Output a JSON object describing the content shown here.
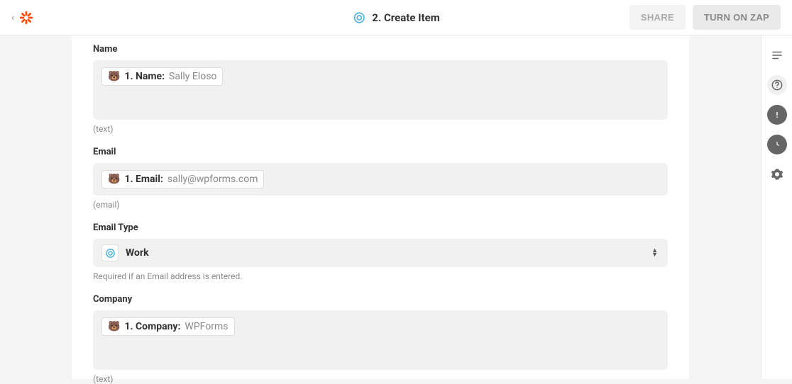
{
  "header": {
    "step_title": "2. Create Item",
    "share_label": "SHARE",
    "turn_on_label": "TURN ON ZAP"
  },
  "fields": {
    "name": {
      "label": "Name",
      "pill_label": "1. Name:",
      "pill_value": "Sally Eloso",
      "hint": "(text)"
    },
    "email": {
      "label": "Email",
      "pill_label": "1. Email:",
      "pill_value": "sally@wpforms.com",
      "hint": "(email)"
    },
    "email_type": {
      "label": "Email Type",
      "value": "Work",
      "hint": "Required if an Email address is entered."
    },
    "company": {
      "label": "Company",
      "pill_label": "1. Company:",
      "pill_value": "WPForms",
      "hint": "(text)"
    }
  }
}
